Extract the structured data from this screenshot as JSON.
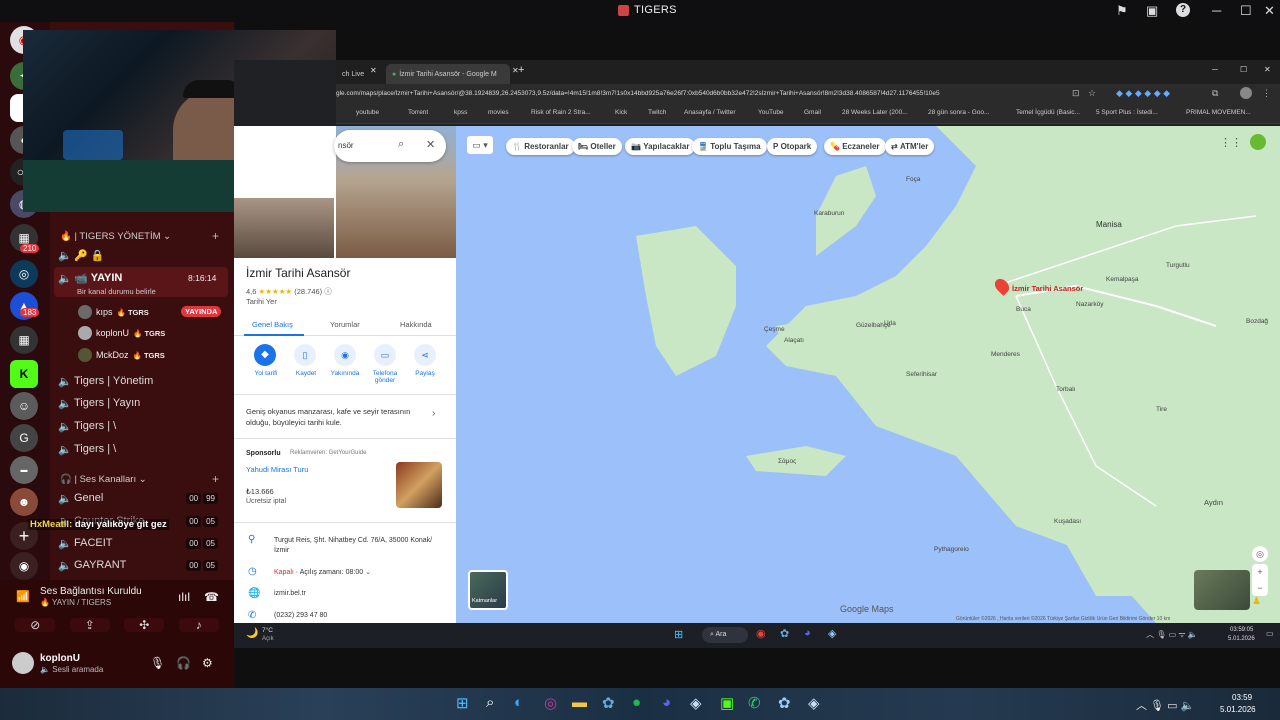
{
  "window": {
    "title": "TIGERS"
  },
  "rail": {
    "badges": [
      "210",
      "183"
    ],
    "letter": "G"
  },
  "channels": {
    "category_mgmt": "| TIGERS YÖNETİM",
    "yayin": {
      "name": "YAYIN",
      "time": "8:16:14",
      "status": "Bir kanal durumu belirle"
    },
    "voice_users": [
      {
        "name": "kıps",
        "tag": "TGRS",
        "live": "YAYINDA"
      },
      {
        "name": "koplonU",
        "tag": "TGRS"
      },
      {
        "name": "MckDoz",
        "tag": "TGRS"
      }
    ],
    "text_channels": [
      "Tigers | Yönetim",
      "Tigers | Yayın",
      "Tigers | \\",
      "Tigers | \\"
    ],
    "voice_category": "| Ses Kanalları",
    "voice_channels": [
      {
        "name": "Genel",
        "a": "00",
        "b": "99"
      },
      {
        "name": "Counter Strike",
        "a": "00",
        "b": "05"
      },
      {
        "name": "FACEIT",
        "a": "00",
        "b": "05"
      },
      {
        "name": "GAYRANT",
        "a": "00",
        "b": "05"
      }
    ],
    "chat_overlay": {
      "user": "HxMeatll",
      "message": "dayı yalıköye git gez"
    }
  },
  "userpanel": {
    "connection": "Ses Bağlantısı Kuruldu",
    "connection_sub": "YAYIN / TIGERS",
    "username": "koplonU",
    "user_status": "Sesli aramada"
  },
  "browser": {
    "tabs": [
      "ch Live",
      "İzmir Tarihi Asansör - Google M"
    ],
    "url": "gle.com/maps/place/İzmir+Tarihi+Asansör/@38.1924839,26.2453073,9.5z/data=!4m15!1m8!3m7!1s0x14bbd925a76e26f7:0xb540d6b0bb32e472!2sİzmir+Tarihi+Asansör!8m2!3d38.4086587!4d27.1176455!10e5",
    "bookmarks": [
      "youtube",
      "Torrent",
      "kpss",
      "movies",
      "Risk of Rain 2 Stra...",
      "Kick",
      "Twitch",
      "Anasayfa / Twitter",
      "YouTube",
      "Gmail",
      "28 Weeks Later (200...",
      "28 gün sonra - Goo...",
      "Temel İçgüdü (Basic...",
      "5 Sport Plus : İstedi...",
      "PRIMAL MOVEMEN..."
    ]
  },
  "maps": {
    "search_text": "nsör",
    "place_title": "İzmir Tarihi Asansör",
    "rating": "4,6",
    "reviews": "(28.746)",
    "category": "Tarihi Yer",
    "tabs": [
      "Genel Bakış",
      "Yorumlar",
      "Hakkında"
    ],
    "actions": [
      "Yol tarifi",
      "Kaydet",
      "Yakınında",
      "Telefona gönder",
      "Paylaş"
    ],
    "description": "Geniş okyanus manzarası, kafe ve seyir terasının olduğu, büyüleyici tarihi kule.",
    "sponsored_label": "Sponsorlu",
    "sponsored_by": "Reklamveren: GetYourGuide",
    "sponsored_title": "Yahudi Mirası Turu",
    "sponsored_price": "₺13.666",
    "sponsored_note": "Ücretsiz iptal",
    "address": "Turgut Reis, Şht. Nihatbey Cd. 76/A, 35000 Konak/İzmir",
    "hours_status": "Kapalı",
    "hours_text": "Açılış zamanı: 08:00",
    "website": "izmir.bel.tr",
    "phone": "(0232) 293 47 80",
    "chips": [
      "Restoranlar",
      "Oteller",
      "Yapılacaklar",
      "Toplu Taşıma",
      "Otopark",
      "Eczaneler",
      "ATM'ler"
    ],
    "marker_label": "İzmir Tarihi Asansör",
    "map_labels": [
      "Manisa",
      "Turgutlu",
      "Buca",
      "Nazarköy",
      "Bozdağ",
      "Menderes",
      "Seferihisar",
      "Tire",
      "Aydın",
      "Kuşadası",
      "Pythagoreio",
      "Karaburun",
      "Çeşme",
      "Alaçatı",
      "Urla",
      "Güzelbahçe",
      "Foça",
      "Kemalpaşa",
      "Torbalı",
      "Σάμος"
    ],
    "layers": "Katmanlar",
    "logo": "Google Maps",
    "footer": "Görüntüler ©2026 , Harita verileri ©2026   Türkiye   Şartlar   Gizlilik   Ürün Geri Bildirimi Gönder   10 km"
  },
  "inner_taskbar": {
    "temp": "7°C",
    "weather": "Açık",
    "search": "Ara",
    "time": "03:59:05",
    "date": "5.01.2026"
  },
  "outer_taskbar": {
    "time": "03:59",
    "date": "5.01.2026"
  }
}
